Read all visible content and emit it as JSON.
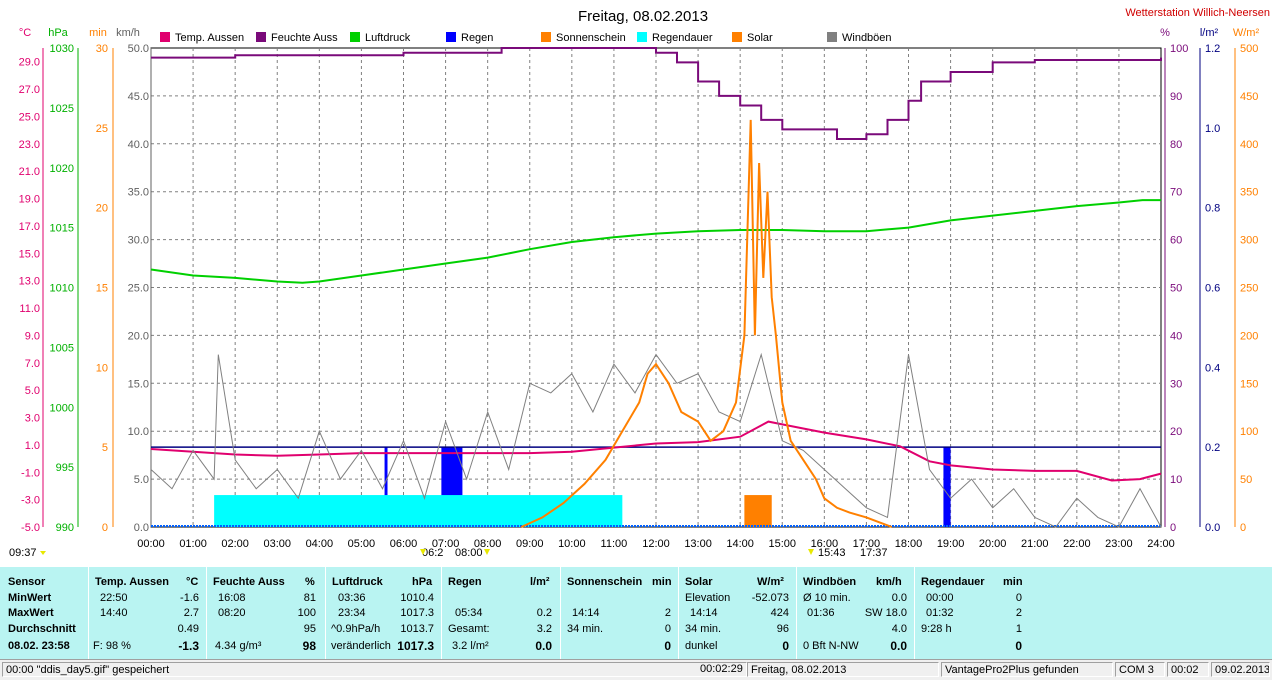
{
  "title": "Freitag, 08.02.2013",
  "station": "Wetterstation Willich-Neersen",
  "legend": [
    {
      "name": "Temp. Aussen",
      "color": "#e0006e"
    },
    {
      "name": "Feuchte Auss",
      "color": "#7a0a7a"
    },
    {
      "name": "Luftdruck",
      "color": "#00d000"
    },
    {
      "name": "Regen",
      "color": "#0000ff"
    },
    {
      "name": "Sonnenschein",
      "color": "#ff8000"
    },
    {
      "name": "Regendauer",
      "color": "#00ffff"
    },
    {
      "name": "Solar",
      "color": "#ff8000"
    },
    {
      "name": "Windböen",
      "color": "#808080"
    }
  ],
  "left_axes": {
    "temp": {
      "unit": "°C",
      "color": "#e0006e",
      "ticks": [
        "29.0",
        "27.0",
        "25.0",
        "23.0",
        "21.0",
        "19.0",
        "17.0",
        "15.0",
        "13.0",
        "11.0",
        "9.0",
        "7.0",
        "5.0",
        "3.0",
        "1.0",
        "-1.0",
        "-3.0",
        "-5.0"
      ]
    },
    "pressure": {
      "unit": "hPa",
      "color": "#00b000",
      "ticks": [
        "1030",
        "1025",
        "1020",
        "1015",
        "1010",
        "1005",
        "1000",
        "995",
        "990"
      ]
    },
    "min": {
      "unit": "min",
      "color": "#ff8000",
      "ticks": [
        "30",
        "25",
        "20",
        "15",
        "10",
        "5",
        "0"
      ]
    },
    "wind": {
      "unit": "km/h",
      "color": "#606060",
      "ticks": [
        "50.0",
        "45.0",
        "40.0",
        "35.0",
        "30.0",
        "25.0",
        "20.0",
        "15.0",
        "10.0",
        "5.0",
        "0.0"
      ]
    }
  },
  "right_axes": {
    "hum": {
      "unit": "%",
      "color": "#7a0a7a",
      "ticks": [
        "100",
        "90",
        "80",
        "70",
        "60",
        "50",
        "40",
        "30",
        "20",
        "10",
        "0"
      ]
    },
    "rain": {
      "unit": "l/m²",
      "color": "#000080",
      "ticks": [
        "1.2",
        "1.0",
        "0.8",
        "0.6",
        "0.4",
        "0.2",
        "0.0"
      ]
    },
    "solar": {
      "unit": "W/m²",
      "color": "#ff8000",
      "ticks": [
        "500",
        "450",
        "400",
        "350",
        "300",
        "250",
        "200",
        "150",
        "100",
        "50",
        "0"
      ]
    }
  },
  "chart_data": {
    "type": "line",
    "x_labels": [
      "00:00",
      "01:00",
      "02:00",
      "03:00",
      "04:00",
      "05:00",
      "06:00",
      "07:00",
      "08:00",
      "09:00",
      "10:00",
      "11:00",
      "12:00",
      "13:00",
      "14:00",
      "15:00",
      "16:00",
      "17:00",
      "18:00",
      "19:00",
      "20:00",
      "21:00",
      "22:00",
      "23:00",
      "24:00"
    ],
    "xlim": [
      0,
      24
    ],
    "series": [
      {
        "name": "Temp. Aussen",
        "axis": "°C",
        "ylim": [
          -5,
          30
        ],
        "color": "#e0006e",
        "x": [
          0,
          1,
          2,
          3,
          4,
          5,
          6,
          7,
          8,
          9,
          10,
          11,
          12,
          13,
          14,
          14.67,
          15,
          15.5,
          16,
          17,
          17.8,
          18.5,
          19,
          20,
          21,
          22,
          22.83,
          23.5,
          24
        ],
        "y": [
          0.7,
          0.5,
          0.3,
          0.2,
          0.3,
          0.4,
          0.4,
          0.4,
          0.4,
          0.4,
          0.5,
          0.8,
          1.1,
          1.2,
          1.6,
          2.7,
          2.5,
          2.2,
          1.9,
          1.4,
          0.9,
          -0.2,
          -0.5,
          -0.8,
          -0.9,
          -0.9,
          -1.6,
          -1.5,
          -1.1
        ]
      },
      {
        "name": "Feuchte Auss",
        "axis": "%",
        "ylim": [
          0,
          100
        ],
        "color": "#7a0a7a",
        "x": [
          0,
          2,
          4,
          6,
          8,
          8.33,
          10,
          11,
          12,
          12.5,
          13,
          13.5,
          14,
          14.5,
          15,
          15.5,
          16,
          16.3,
          17,
          17.5,
          18,
          18.3,
          19,
          20,
          21,
          22,
          23,
          24
        ],
        "y": [
          98,
          98.5,
          98.5,
          99,
          99,
          100,
          100,
          100,
          99,
          97,
          93,
          90,
          88,
          85,
          83,
          83,
          83,
          81,
          82,
          85,
          89,
          93,
          95,
          97,
          97.5,
          97.5,
          97.5,
          98
        ]
      },
      {
        "name": "Luftdruck",
        "axis": "hPa",
        "ylim": [
          990,
          1030
        ],
        "color": "#00d000",
        "x": [
          0,
          1,
          2,
          3,
          3.6,
          4,
          5,
          6,
          7,
          8,
          9,
          10,
          11,
          12,
          13,
          14,
          15,
          16,
          17,
          18,
          19,
          20,
          21,
          22,
          23,
          23.56,
          24
        ],
        "y": [
          1011.5,
          1011,
          1010.8,
          1010.5,
          1010.4,
          1010.5,
          1011,
          1011.5,
          1012,
          1012.5,
          1013.2,
          1013.8,
          1014.2,
          1014.5,
          1014.7,
          1014.8,
          1014.8,
          1014.7,
          1014.7,
          1015,
          1015.6,
          1016,
          1016.4,
          1016.8,
          1017.1,
          1017.3,
          1017.3
        ]
      },
      {
        "name": "Windböen",
        "axis": "km/h",
        "ylim": [
          0,
          50
        ],
        "color": "#808080",
        "x": [
          0,
          0.5,
          1,
          1.5,
          1.6,
          2,
          2.5,
          3,
          3.5,
          4,
          4.5,
          5,
          5.5,
          6,
          6.5,
          7,
          7.5,
          8,
          8.5,
          9,
          9.5,
          10,
          10.5,
          11,
          11.5,
          12,
          12.5,
          13,
          13.5,
          14,
          14.5,
          15,
          15.5,
          16,
          16.5,
          17,
          17.5,
          18,
          18.5,
          19,
          19.5,
          20,
          20.5,
          21,
          21.5,
          22,
          22.5,
          23,
          23.5,
          24
        ],
        "y": [
          6,
          4,
          8,
          5,
          18,
          7,
          4,
          6,
          3,
          10,
          5,
          8,
          4,
          9,
          3,
          11,
          5,
          12,
          6,
          15,
          14,
          16,
          12,
          17,
          14,
          18,
          15,
          16,
          12,
          11,
          18,
          9,
          8,
          6,
          4,
          2,
          1,
          18,
          6,
          3,
          5,
          2,
          4,
          1,
          0,
          3,
          1,
          0,
          4,
          0
        ]
      },
      {
        "name": "Solar",
        "axis": "W/m²",
        "ylim": [
          0,
          500
        ],
        "color": "#ff8000",
        "x": [
          8.8,
          9.3,
          9.8,
          10.3,
          10.8,
          11.2,
          11.6,
          11.8,
          12,
          12.3,
          12.6,
          13,
          13.3,
          13.6,
          13.9,
          14.1,
          14.25,
          14.35,
          14.45,
          14.55,
          14.65,
          14.75,
          14.85,
          15,
          15.2,
          15.5,
          15.8,
          16,
          16.3,
          16.6,
          17,
          17.3,
          17.6
        ],
        "y": [
          0,
          10,
          25,
          45,
          70,
          100,
          130,
          160,
          170,
          150,
          120,
          110,
          90,
          100,
          130,
          200,
          425,
          200,
          380,
          260,
          350,
          240,
          200,
          130,
          90,
          70,
          50,
          30,
          20,
          15,
          10,
          5,
          0
        ]
      },
      {
        "name": "Sonnenschein",
        "axis": "min",
        "ylim": [
          0,
          30
        ],
        "color": "#ff8000",
        "bars": [
          {
            "from": 14.1,
            "to": 14.75,
            "value": 2
          }
        ]
      },
      {
        "name": "Regen",
        "axis": "l/m²",
        "ylim": [
          0,
          1.2
        ],
        "color": "#0000ff",
        "bars": [
          {
            "from": 5.55,
            "to": 5.62,
            "value": 0.2
          },
          {
            "from": 6.9,
            "to": 7.4,
            "value": 0.2
          },
          {
            "from": 18.83,
            "to": 19.0,
            "value": 0.2
          }
        ]
      },
      {
        "name": "Regendauer",
        "axis": "min",
        "ylim": [
          0,
          30
        ],
        "color": "#00ffff",
        "bars": [
          {
            "from": 1.5,
            "to": 11.2,
            "value": 2
          }
        ]
      }
    ]
  },
  "marks": {
    "left": "09:37",
    "sunrise": "06:2",
    "t0800": "08:00",
    "t1543": "15:43",
    "sunset": "17:37"
  },
  "table": {
    "sensor": {
      "header": "Sensor",
      "rows": [
        "MinWert",
        "MaxWert",
        "Durchschnitt",
        "08.02. 23:58"
      ]
    },
    "temp": {
      "header": "Temp. Aussen",
      "unit": "°C",
      "rows": [
        [
          "22:50",
          "-1.6"
        ],
        [
          "14:40",
          "2.7"
        ],
        [
          "",
          "0.49"
        ],
        [
          "F: 98 %",
          "-1.3"
        ]
      ]
    },
    "feuchte": {
      "header": "Feuchte Auss",
      "unit": "%",
      "rows": [
        [
          "16:08",
          "81"
        ],
        [
          "08:20",
          "100"
        ],
        [
          "",
          "95"
        ],
        [
          "4.34 g/m³",
          "98"
        ]
      ]
    },
    "druck": {
      "header": "Luftdruck",
      "unit": "hPa",
      "rows": [
        [
          "03:36",
          "1010.4"
        ],
        [
          "23:34",
          "1017.3"
        ],
        [
          "^0.9hPa/h",
          "1013.7"
        ],
        [
          "veränderlich",
          "1017.3"
        ]
      ]
    },
    "regen": {
      "header": "Regen",
      "unit": "l/m²",
      "rows": [
        [
          "",
          ""
        ],
        [
          "05:34",
          "0.2"
        ],
        [
          "Gesamt:",
          "3.2"
        ],
        [
          "3.2 l/m²",
          "0.0"
        ]
      ]
    },
    "sonne": {
      "header": "Sonnenschein",
      "unit": "min",
      "rows": [
        [
          "",
          ""
        ],
        [
          "14:14",
          "2"
        ],
        [
          "34 min.",
          "0"
        ],
        [
          "",
          "0"
        ]
      ]
    },
    "solar": {
      "header": "Solar",
      "unit": "W/m²",
      "rows": [
        [
          "Elevation",
          "-52.073"
        ],
        [
          "14:14",
          "424"
        ],
        [
          "34 min.",
          "96"
        ],
        [
          "dunkel",
          "0"
        ]
      ]
    },
    "wind": {
      "header": "Windböen",
      "unit": "km/h",
      "rows": [
        [
          "Ø 10 min.",
          "0.0"
        ],
        [
          "01:36",
          "SW 18.0"
        ],
        [
          "",
          "4.0"
        ],
        [
          "0 Bft N-NW",
          "0.0"
        ]
      ]
    },
    "regendauer": {
      "header": "Regendauer",
      "unit": "min",
      "rows": [
        [
          "00:00",
          "0"
        ],
        [
          "01:32",
          "2"
        ],
        [
          "9:28 h",
          "1"
        ],
        [
          "",
          "0"
        ]
      ]
    }
  },
  "statusbar": {
    "msg": "00:00  \"ddis_day5.gif\"  gespeichert",
    "time": "00:02:29",
    "date": "Freitag, 08.02.2013",
    "device": "VantagePro2Plus gefunden",
    "com": "COM 3",
    "clock": "00:02",
    "day": "09.02.2013"
  }
}
